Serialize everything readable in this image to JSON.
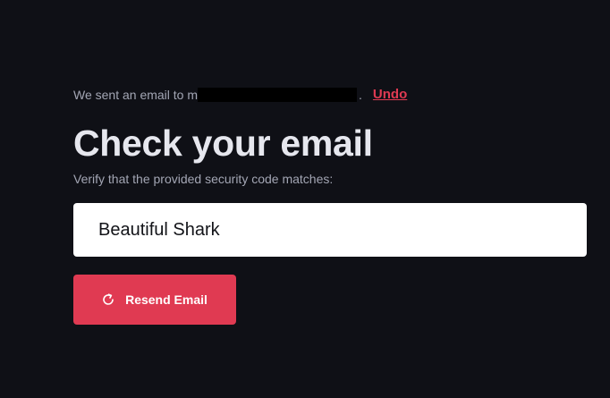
{
  "notice": {
    "prefix": "We sent an email to m",
    "suffix": ".",
    "undo_label": "Undo"
  },
  "title": "Check your email",
  "subtitle": "Verify that the provided security code matches:",
  "security_code": "Beautiful Shark",
  "resend_button": {
    "label": "Resend Email",
    "icon": "refresh-icon"
  },
  "colors": {
    "background": "#0f1016",
    "accent": "#e03a52",
    "muted_text": "#a3a6b4",
    "title_text": "#e6e7ee"
  }
}
